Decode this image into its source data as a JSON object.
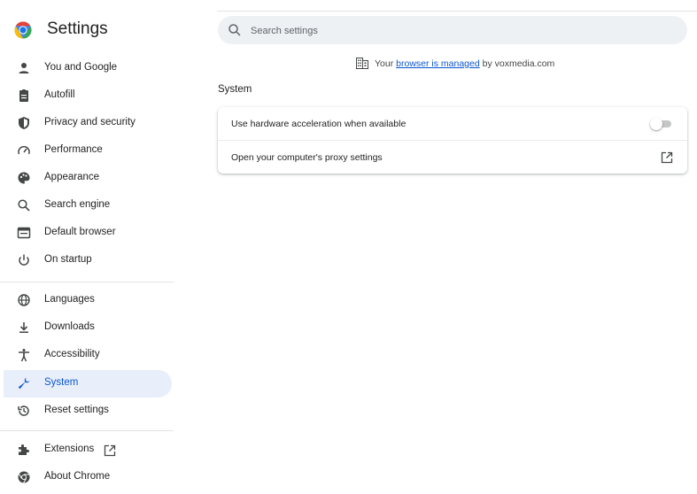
{
  "app": {
    "title": "Settings"
  },
  "search": {
    "placeholder": "Search settings"
  },
  "sidebar": {
    "items": [
      {
        "label": "You and Google",
        "icon": "person-icon"
      },
      {
        "label": "Autofill",
        "icon": "clipboard-icon"
      },
      {
        "label": "Privacy and security",
        "icon": "shield-icon"
      },
      {
        "label": "Performance",
        "icon": "speedometer-icon"
      },
      {
        "label": "Appearance",
        "icon": "palette-icon"
      },
      {
        "label": "Search engine",
        "icon": "search-icon"
      },
      {
        "label": "Default browser",
        "icon": "browser-window-icon"
      },
      {
        "label": "On startup",
        "icon": "power-icon"
      },
      {
        "label": "Languages",
        "icon": "globe-icon"
      },
      {
        "label": "Downloads",
        "icon": "download-icon"
      },
      {
        "label": "Accessibility",
        "icon": "accessibility-icon"
      },
      {
        "label": "System",
        "icon": "wrench-icon",
        "active": true
      },
      {
        "label": "Reset settings",
        "icon": "history-icon"
      },
      {
        "label": "Extensions",
        "icon": "puzzle-icon"
      },
      {
        "label": "About Chrome",
        "icon": "chrome-icon"
      }
    ]
  },
  "managed": {
    "prefix": "Your ",
    "link": "browser is managed",
    "suffix": " by voxmedia.com"
  },
  "section": {
    "title": "System"
  },
  "settings": {
    "hardware_acceleration": {
      "label": "Use hardware acceleration when available",
      "enabled": false
    },
    "proxy": {
      "label": "Open your computer's proxy settings"
    }
  },
  "colors": {
    "accent": "#0b57d0",
    "active_bg": "#e8effb",
    "search_bg": "#eef1f4"
  }
}
